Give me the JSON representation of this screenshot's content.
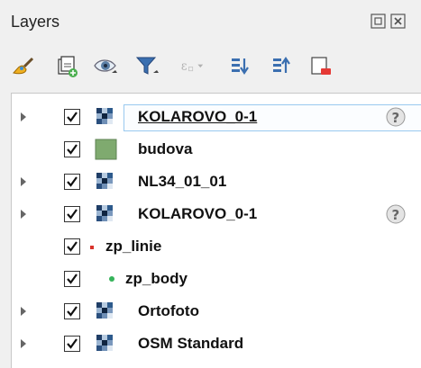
{
  "panel": {
    "title": "Layers"
  },
  "toolbar": {
    "items": [
      "style-brush-icon",
      "add-group-icon",
      "visibility-eye-icon",
      "filter-icon",
      "expression-filter-icon",
      "expand-all-icon",
      "collapse-all-icon",
      "remove-layer-icon"
    ]
  },
  "layers": [
    {
      "name": "KOLAROVO_0-1",
      "icon": "raster-icon",
      "expandable": true,
      "checked": true,
      "selected": true,
      "hint": true
    },
    {
      "name": "budova",
      "icon": "polygon-fill-icon",
      "expandable": false,
      "checked": true,
      "fill": "#7faa6f"
    },
    {
      "name": "NL34_01_01",
      "icon": "raster-icon",
      "expandable": true,
      "checked": true
    },
    {
      "name": "KOLAROVO_0-1",
      "icon": "raster-icon",
      "expandable": true,
      "checked": true,
      "hint": true
    },
    {
      "name": "zp_linie",
      "icon": "line-symbol-icon",
      "expandable": false,
      "checked": true,
      "color": "#d9332b"
    },
    {
      "name": "zp_body",
      "icon": "point-symbol-icon",
      "expandable": false,
      "checked": true,
      "color": "#35b35a"
    },
    {
      "name": "Ortofoto",
      "icon": "raster-icon",
      "expandable": true,
      "checked": true
    },
    {
      "name": "OSM Standard",
      "icon": "raster-icon",
      "expandable": true,
      "checked": true
    }
  ]
}
